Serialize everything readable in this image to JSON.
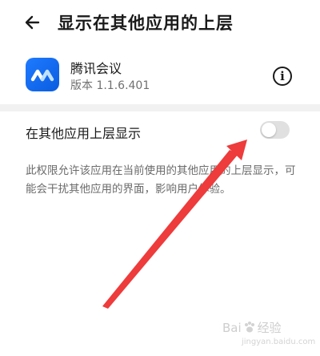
{
  "header": {
    "title": "显示在其他应用的上层"
  },
  "app": {
    "name": "腾讯会议",
    "version": "版本 1.1.6.401"
  },
  "setting": {
    "label": "在其他应用上层显示",
    "enabled": false
  },
  "description": "此权限允许该应用在当前使用的其他应用的上层显示，可能会干扰其他应用的界面，影响用户体验。",
  "colors": {
    "accent": "#1f7bff",
    "arrow": "#ee3b3b",
    "toggle_off": "#e0e0e0"
  },
  "watermark": {
    "text_left": "Bai",
    "text_right": "经验",
    "subtitle": "jingyan.baidu.com"
  }
}
